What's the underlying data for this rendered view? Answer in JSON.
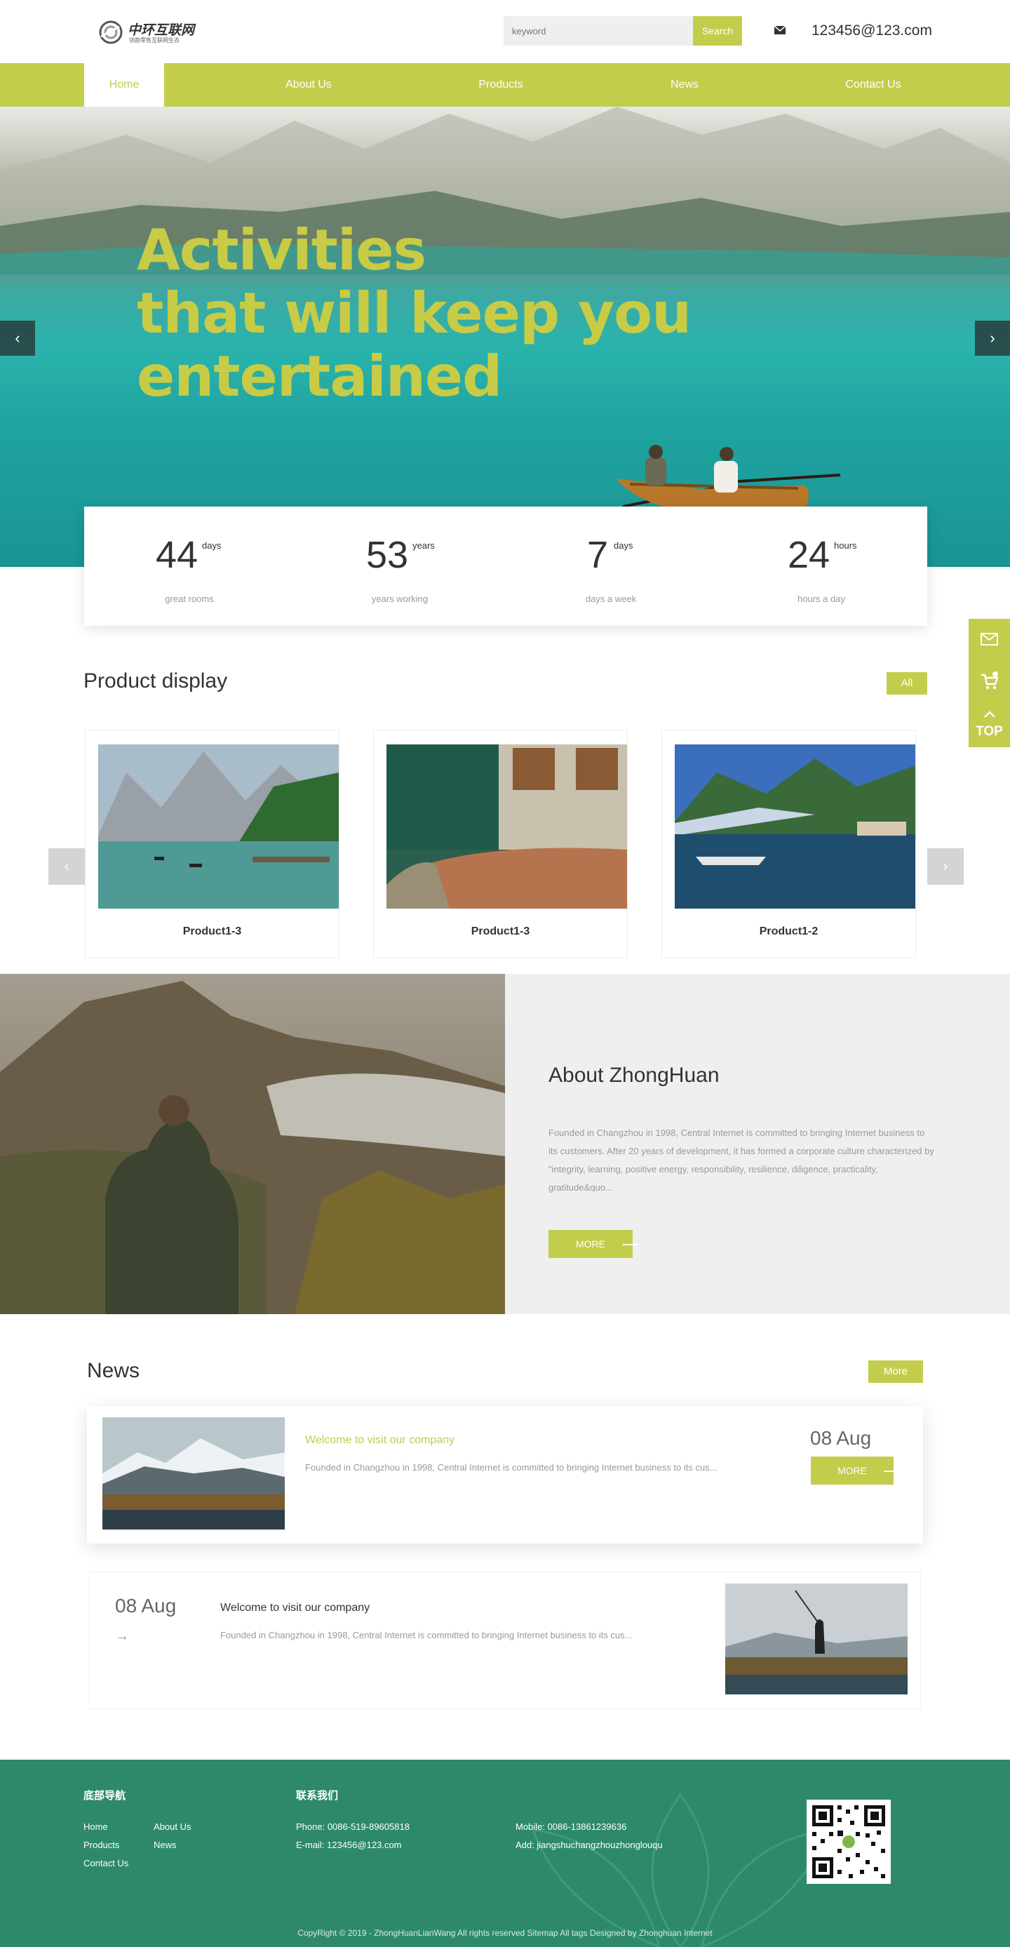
{
  "header": {
    "logo_title": "中环互联网",
    "logo_sub": "领跑零售互联网生态",
    "search_placeholder": "keyword",
    "search_button": "Search",
    "email": "123456@123.com"
  },
  "nav": {
    "items": [
      {
        "label": "Home",
        "active": true
      },
      {
        "label": "About Us"
      },
      {
        "label": "Products"
      },
      {
        "label": "News"
      },
      {
        "label": "Contact Us"
      }
    ]
  },
  "hero": {
    "title_lines": [
      "Activities",
      "that will keep you",
      "entertained"
    ],
    "prev_glyph": "‹",
    "next_glyph": "›"
  },
  "stats": [
    {
      "number": "44",
      "unit": "days",
      "label": "great rooms"
    },
    {
      "number": "53",
      "unit": "years",
      "label": "years working"
    },
    {
      "number": "7",
      "unit": "days",
      "label": "days a week"
    },
    {
      "number": "24",
      "unit": "hours",
      "label": "hours a day"
    }
  ],
  "products": {
    "title": "Product display",
    "all_button": "All",
    "items": [
      {
        "name": "Product1-3"
      },
      {
        "name": "Product1-3"
      },
      {
        "name": "Product1-2"
      }
    ],
    "prev_glyph": "‹",
    "next_glyph": "›"
  },
  "about": {
    "title": "About ZhongHuan",
    "text": "Founded in Changzhou in 1998, Central Internet is committed to bringing Internet business to its customers. After 20 years of development, it has formed a corporate culture characterized by \"integrity, learning, positive energy, responsibility, resilience, diligence, practicality, gratitude&quo...",
    "more_button": "MORE"
  },
  "news": {
    "title": "News",
    "more_button": "More",
    "items": [
      {
        "title": "Welcome to visit our company",
        "text": "Founded in Changzhou in 1998, Central Internet is committed to bringing Internet business to its cus...",
        "date": "08 Aug",
        "more": "MORE"
      },
      {
        "title": "Welcome to visit our company",
        "text": "Founded in Changzhou in 1998, Central Internet is committed to bringing Internet business to its cus...",
        "date": "08 Aug",
        "arrow": "→"
      }
    ]
  },
  "floater": {
    "top_label": "TOP"
  },
  "footer": {
    "nav_heading": "底部导航",
    "contact_heading": "联系我们",
    "links": [
      "Home",
      "About Us",
      "Products",
      "News",
      "Contact Us"
    ],
    "phone": "Phone: 0086-519-89605818",
    "email": "E-mail: 123456@123.com",
    "mobile": "Mobile: 0086-13861239636",
    "address": "Add: jiangshuchangzhouzhonglouqu",
    "copyright": "CopyRight © 2019 -  ZhongHuanLianWang  All rights reserved     Sitemap  All tags   Designed by Zhonghuan Internet"
  },
  "colors": {
    "accent": "#c2cd4c",
    "footer": "#2e896c",
    "hero_title": "#c8cb45"
  }
}
